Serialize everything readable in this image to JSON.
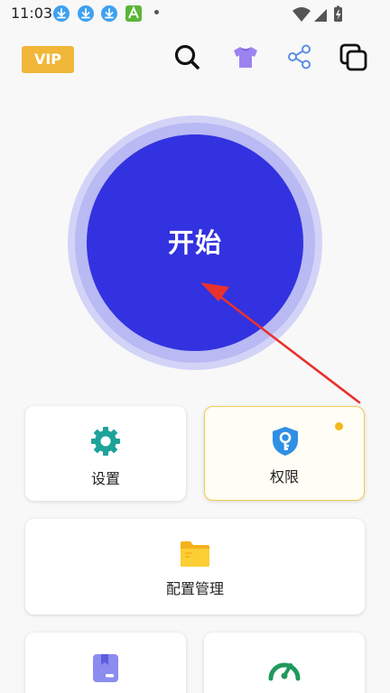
{
  "status_bar": {
    "time": "11:03",
    "icons": [
      "download-icon",
      "download-icon",
      "download-icon",
      "app-notification-icon",
      "more-dot-icon",
      "wifi-icon",
      "signal-icon",
      "battery-icon"
    ]
  },
  "header": {
    "vip_label": "VIP",
    "icons": [
      "search-icon",
      "theme-shirt-icon",
      "share-icon",
      "copy-icon"
    ]
  },
  "start_button": {
    "label": "开始"
  },
  "menu": {
    "settings_label": "设置",
    "permissions_label": "权限",
    "config_label": "配置管理"
  },
  "colors": {
    "vip": "#f0b739",
    "start_inner": "#3232e0",
    "start_ring": "#b9b9f4",
    "start_halo": "#d3d3f8",
    "settings_icon": "#1ea39a",
    "permissions_icon": "#2f8fe5",
    "folder_icon": "#f7c325",
    "highlight_border": "#f2cc4b",
    "arrow": "#e8322e"
  }
}
